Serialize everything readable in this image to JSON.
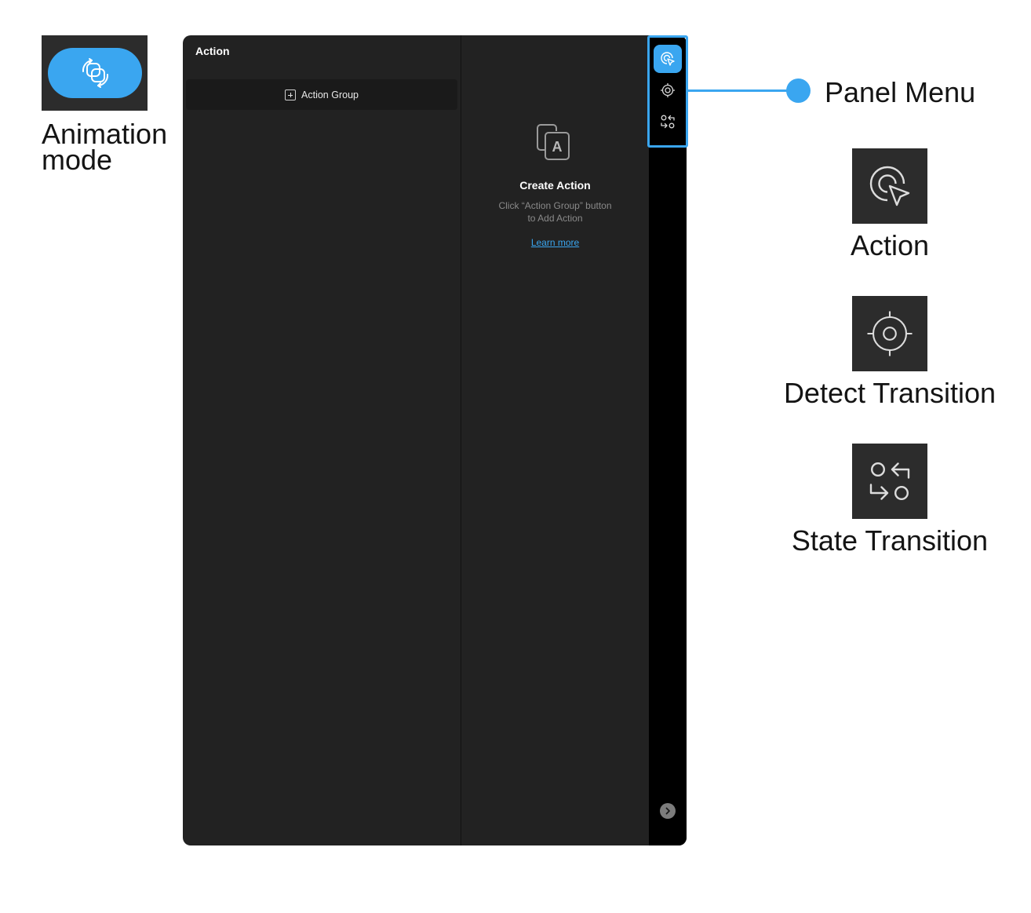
{
  "annotations": {
    "animation_mode_label_line1": "Animation",
    "animation_mode_label_line2": "mode",
    "panel_menu_label": "Panel Menu",
    "legend": [
      {
        "label": "Action",
        "icon": "action-cursor-icon"
      },
      {
        "label": "Detect Transition",
        "icon": "detect-target-icon"
      },
      {
        "label": "State Transition",
        "icon": "state-transition-icon"
      }
    ]
  },
  "panel": {
    "title": "Action",
    "action_group_button": "Action Group",
    "empty_state": {
      "icon": "create-action-icon",
      "title": "Create Action",
      "description_line1": "Click “Action Group” button",
      "description_line2": "to Add Action",
      "link": "Learn more"
    },
    "menu": [
      {
        "name": "action",
        "icon": "action-cursor-icon",
        "active": true
      },
      {
        "name": "detect-transition",
        "icon": "detect-target-icon",
        "active": false
      },
      {
        "name": "state-transition",
        "icon": "state-transition-icon",
        "active": false
      }
    ],
    "expand_icon": "chevron-right-icon"
  },
  "colors": {
    "accent": "#3aa6f0",
    "panel_bg": "#222222",
    "menu_strip_bg": "#000000",
    "tile_bg": "#2c2c2c"
  }
}
